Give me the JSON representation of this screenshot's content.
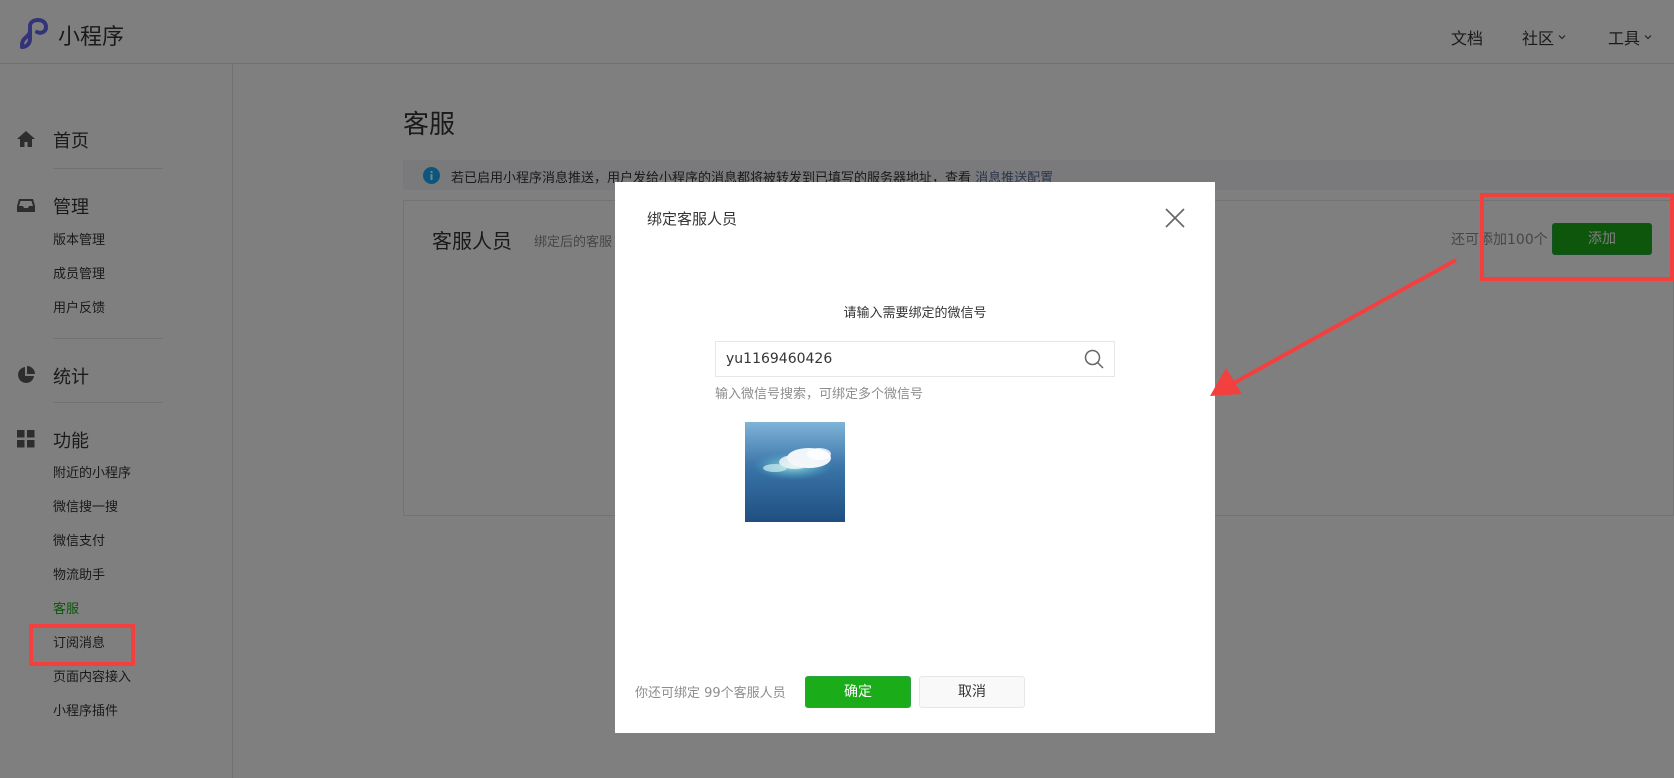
{
  "header": {
    "brand": "小程序",
    "nav": {
      "docs": "文档",
      "community": "社区",
      "tools": "工具"
    }
  },
  "sidebar": {
    "home": "首页",
    "manage": "管理",
    "manage_items": [
      "版本管理",
      "成员管理",
      "用户反馈"
    ],
    "stats": "统计",
    "features": "功能",
    "feature_items": [
      "附近的小程序",
      "微信搜一搜",
      "微信支付",
      "物流助手",
      "客服",
      "订阅消息",
      "页面内容接入",
      "小程序插件"
    ],
    "active_item": "客服"
  },
  "main": {
    "title": "客服",
    "notice": {
      "text": "若已启用小程序消息推送，用户发给小程序的消息都将被转发到已填写的服务器地址，查看",
      "link": "消息推送配置"
    },
    "panel": {
      "title": "客服人员",
      "desc": "绑定后的客服",
      "remaining": "还可添加100个",
      "add_button": "添加"
    }
  },
  "dialog": {
    "title": "绑定客服人员",
    "prompt": "请输入需要绑定的微信号",
    "search_value": "yu1169460426",
    "hint": "输入微信号搜索，可绑定多个微信号",
    "footer_tip": "你还可绑定 99个客服人员",
    "confirm": "确定",
    "cancel": "取消"
  },
  "colors": {
    "accent": "#1aad19",
    "highlight": "#f43f3f",
    "link": "#576b95",
    "info": "#10aeff"
  }
}
